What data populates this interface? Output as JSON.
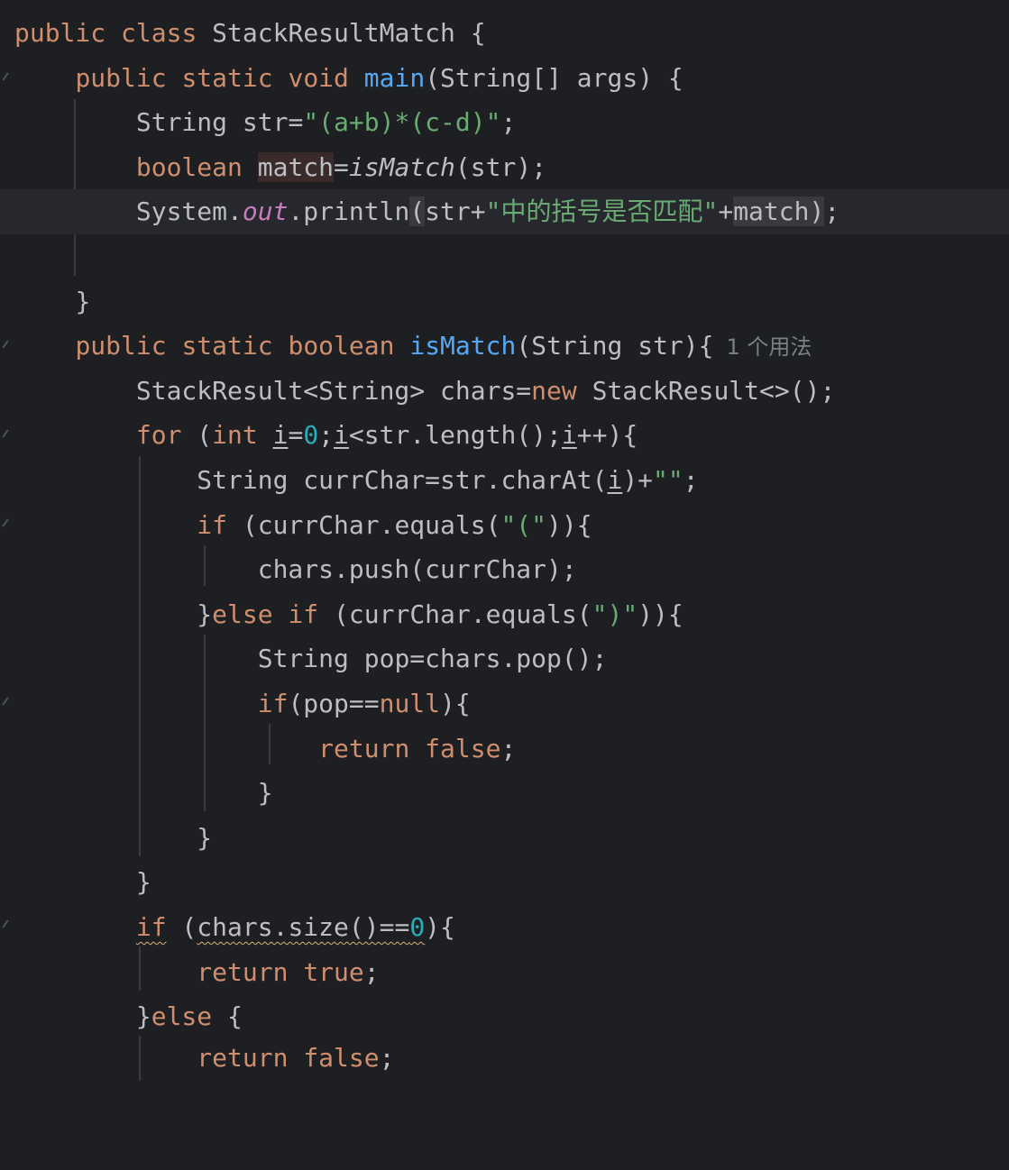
{
  "editor": {
    "theme": {
      "background": "#1e1f22",
      "text": "#bcbec4",
      "keyword": "#cf8e6d",
      "function": "#56a8f5",
      "string": "#6aab73",
      "number": "#2aacb8",
      "static_field": "#c77dbb",
      "hint": "#7a7e85"
    },
    "tokens": {
      "public": "public",
      "class": "class",
      "static": "static",
      "void": "void",
      "boolean": "boolean",
      "new": "new",
      "for": "for",
      "int": "int",
      "if": "if",
      "else": "else",
      "return": "return",
      "false": "false",
      "true": "true",
      "null": "null",
      "class_name": "StackResultMatch",
      "main": "main",
      "main_params": "(String[] args) {",
      "String": "String",
      "str_assign": " str=",
      "str_literal": "\"(a+b)*(c-d)\"",
      "semicolon": ";",
      "match": "match",
      "eq": "=",
      "isMatch": "isMatch",
      "call_str": "(str);",
      "system": "System.",
      "out": "out",
      "println": ".println",
      "open_paren": "(",
      "close_paren": ")",
      "str_plus": "str+",
      "cn_literal": "\"中的括号是否匹配\"",
      "plus": "+",
      "close_brace": "}",
      "ismatch_params": "(String str){",
      "usage_hint": "1 个用法",
      "stack_decl": "StackResult<String> chars=",
      "stack_ctor": " StackResult<>();",
      "for_open": " (",
      "i": "i",
      "zero": "0",
      "lt_length": "<str.length();",
      "incr": "++){",
      "curr_decl": " currChar=str.charAt(",
      "paren_concat": ")+",
      "empty_literal": "\"\"",
      "if_equals": " (currChar.equals(",
      "open_literal": "\"(\"",
      "cond_close": ")){",
      "push": "chars.push(currChar);",
      "else_open": "}",
      "close_literal": "\")\"",
      "pop_decl": " pop=chars.pop();",
      "if_pop": "(pop==",
      "brace_open": "){",
      "space_brace": " {",
      "if_size_open": " (",
      "size_call": "chars.size()==",
      "size_zero": "0",
      "size_close": "){"
    }
  }
}
